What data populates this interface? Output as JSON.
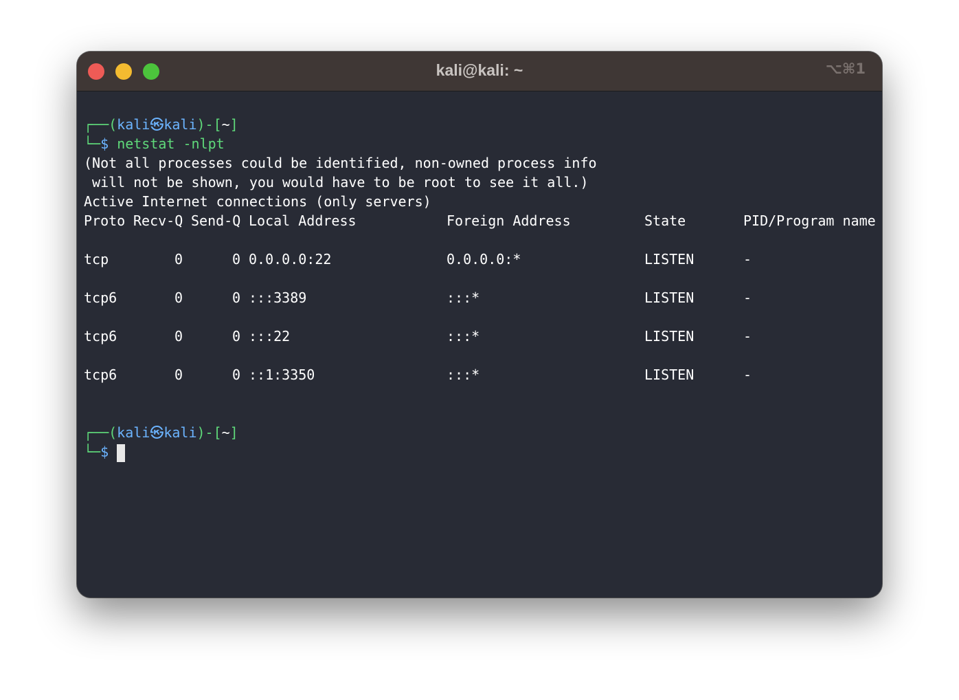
{
  "window": {
    "title": "kali@kali: ~",
    "shortcut": "⌥⌘1"
  },
  "prompt": {
    "open_corner": "┌──",
    "open_paren": "(",
    "user_host": "kali㉿kali",
    "close_paren": ")-[",
    "cwd": "~",
    "close_bracket": "]",
    "close_corner": "└─",
    "symbol": "$"
  },
  "command": "netstat -nlpt",
  "output": {
    "warning_line1": "(Not all processes could be identified, non-owned process info",
    "warning_line2": " will not be shown, you would have to be root to see it all.)",
    "heading": "Active Internet connections (only servers)",
    "columns": [
      "Proto",
      "Recv-Q",
      "Send-Q",
      "Local Address",
      "Foreign Address",
      "State",
      "PID/Program name"
    ],
    "rows": [
      {
        "proto": "tcp",
        "recvq": "0",
        "sendq": "0",
        "local": "0.0.0.0:22",
        "foreign": "0.0.0.0:*",
        "state": "LISTEN",
        "pid": "-"
      },
      {
        "proto": "tcp6",
        "recvq": "0",
        "sendq": "0",
        "local": ":::3389",
        "foreign": ":::*",
        "state": "LISTEN",
        "pid": "-"
      },
      {
        "proto": "tcp6",
        "recvq": "0",
        "sendq": "0",
        "local": ":::22",
        "foreign": ":::*",
        "state": "LISTEN",
        "pid": "-"
      },
      {
        "proto": "tcp6",
        "recvq": "0",
        "sendq": "0",
        "local": "::1:3350",
        "foreign": ":::*",
        "state": "LISTEN",
        "pid": "-"
      }
    ]
  },
  "colors": {
    "terminal_bg": "#282b35",
    "titlebar_bg": "#3f3735",
    "prompt_green": "#5fd97a",
    "prompt_blue": "#6cb4ff"
  }
}
